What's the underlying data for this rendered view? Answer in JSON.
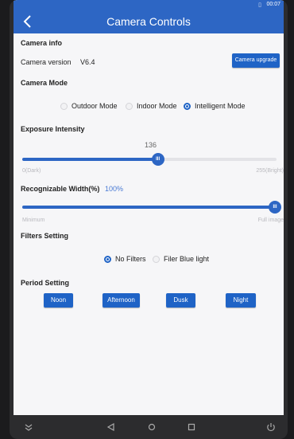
{
  "status": {
    "time": "00:07",
    "signal_icon": "sim-icon"
  },
  "header": {
    "title": "Camera Controls",
    "back_icon": "back-arrow-icon"
  },
  "camera_info": {
    "title": "Camera info",
    "version_label": "Camera version",
    "version_value": "V6.4",
    "upgrade_button": "Camera upgrade"
  },
  "camera_mode": {
    "title": "Camera Mode",
    "options": [
      "Outdoor Mode",
      "Indoor Mode",
      "Intelligent Mode"
    ],
    "selected": "Intelligent Mode"
  },
  "exposure": {
    "title": "Exposure Intensity",
    "value": "136",
    "min_label": "0(Dark)",
    "max_label": "255(Bright)",
    "min": 0,
    "max": 255,
    "current": 136
  },
  "width": {
    "title": "Recognizable Width(%)",
    "value_text": "100%",
    "min_label": "Minimum",
    "max_label": "Full image",
    "fraction": 1.0
  },
  "filters": {
    "title": "Filters Setting",
    "options": [
      "No Filters",
      "Filer Blue light"
    ],
    "selected": "No Filters"
  },
  "period": {
    "title": "Period Setting",
    "buttons": [
      "Noon",
      "Afternoon",
      "Dusk",
      "Night"
    ]
  },
  "colors": {
    "accent": "#2d66c4",
    "button": "#1f63c6",
    "background": "#f6f6f8"
  }
}
